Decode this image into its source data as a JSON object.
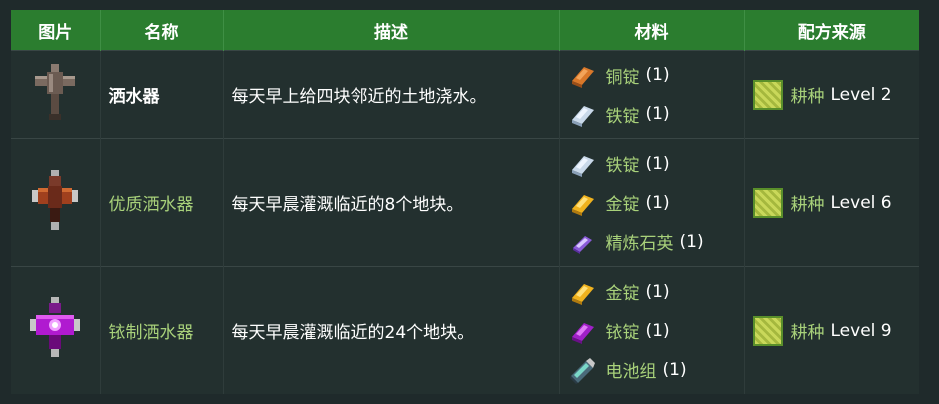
{
  "headers": [
    "图片",
    "名称",
    "描述",
    "材料",
    "配方来源"
  ],
  "rows": [
    {
      "icon": "sprinkler-icon",
      "name": "洒水器",
      "desc": "每天早上给四块邻近的土地浇水。",
      "materials": [
        {
          "icon": "copper-bar-icon",
          "name": "铜锭",
          "qty": "(1)"
        },
        {
          "icon": "iron-bar-icon",
          "name": "铁锭",
          "qty": "(1)"
        }
      ],
      "source": {
        "icon": "farming-skill-icon",
        "skill": "耕种",
        "level": "Level 2"
      }
    },
    {
      "icon": "quality-sprinkler-icon",
      "name": "优质洒水器",
      "desc": "每天早晨灌溉临近的8个地块。",
      "materials": [
        {
          "icon": "iron-bar-icon",
          "name": "铁锭",
          "qty": "(1)"
        },
        {
          "icon": "gold-bar-icon",
          "name": "金锭",
          "qty": "(1)"
        },
        {
          "icon": "refined-quartz-icon",
          "name": "精炼石英",
          "qty": "(1)"
        }
      ],
      "source": {
        "icon": "farming-skill-icon",
        "skill": "耕种",
        "level": "Level 6"
      }
    },
    {
      "icon": "iridium-sprinkler-icon",
      "name": "铱制洒水器",
      "desc": "每天早晨灌溉临近的24个地块。",
      "materials": [
        {
          "icon": "gold-bar-icon",
          "name": "金锭",
          "qty": "(1)"
        },
        {
          "icon": "iridium-bar-icon",
          "name": "铱锭",
          "qty": "(1)"
        },
        {
          "icon": "battery-pack-icon",
          "name": "电池组",
          "qty": "(1)"
        }
      ],
      "source": {
        "icon": "farming-skill-icon",
        "skill": "耕种",
        "level": "Level 9"
      }
    }
  ]
}
